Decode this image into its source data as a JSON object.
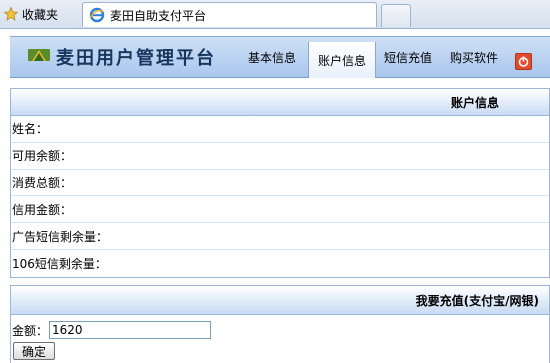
{
  "browser": {
    "favorites_label": "收藏夹",
    "tab_title": "麦田自助支付平台"
  },
  "app": {
    "title": "麦田用户管理平台",
    "nav": [
      "基本信息",
      "账户信息",
      "短信充值",
      "购买软件"
    ],
    "active_nav_index": 1
  },
  "account": {
    "header": "账户信息",
    "fields": [
      "姓名：",
      "可用余额：",
      "消费总额：",
      "信用金额：",
      "广告短信剩余量：",
      "106短信剩余量："
    ]
  },
  "recharge": {
    "header": "我要充值(支付宝/网银)",
    "amount_label": "金额：",
    "amount_value": "1620",
    "confirm_label": "确定"
  },
  "colors": {
    "header_blue": "#a9c6ec",
    "title_navy": "#17365d",
    "power_red": "#e24c2e"
  },
  "icons": {
    "favorites": "star-icon",
    "tab": "ie-icon",
    "logo": "app-logo-icon",
    "power": "power-icon"
  }
}
